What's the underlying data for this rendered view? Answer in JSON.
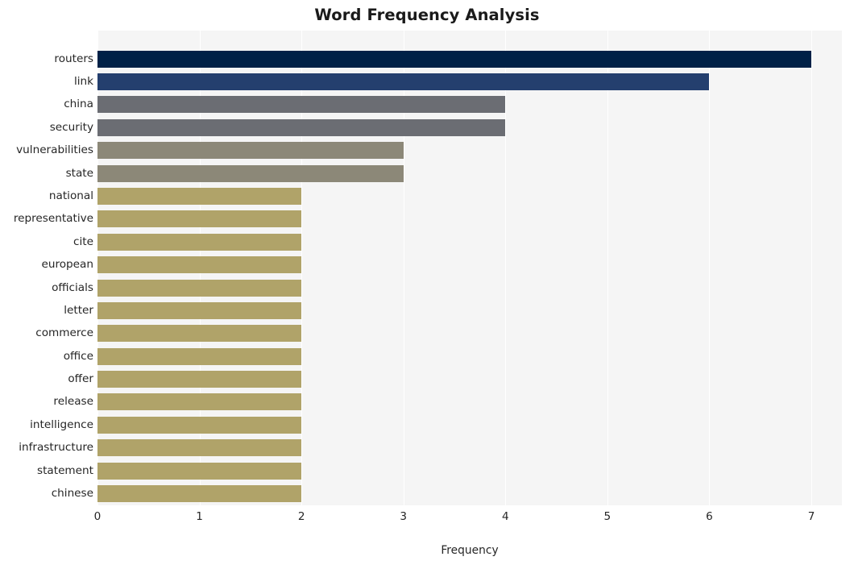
{
  "chart_data": {
    "type": "bar",
    "orientation": "horizontal",
    "title": "Word Frequency Analysis",
    "xlabel": "Frequency",
    "ylabel": "",
    "xlim": [
      0,
      7.3
    ],
    "xticks": [
      0,
      1,
      2,
      3,
      4,
      5,
      6,
      7
    ],
    "xticklabels": [
      "0",
      "1",
      "2",
      "3",
      "4",
      "5",
      "6",
      "7"
    ],
    "grid": true,
    "grid_axis": "x",
    "legend": false,
    "plot_background": "#f5f5f5",
    "figure_background": "#ffffff",
    "gridline_color": "#ffffff",
    "categories": [
      "routers",
      "link",
      "china",
      "security",
      "vulnerabilities",
      "state",
      "national",
      "representative",
      "cite",
      "european",
      "officials",
      "letter",
      "commerce",
      "office",
      "offer",
      "release",
      "intelligence",
      "infrastructure",
      "statement",
      "chinese"
    ],
    "values": [
      7,
      6,
      4,
      4,
      3,
      3,
      2,
      2,
      2,
      2,
      2,
      2,
      2,
      2,
      2,
      2,
      2,
      2,
      2,
      2
    ],
    "bar_colors": [
      "#002147",
      "#243f6e",
      "#6b6d73",
      "#6b6d73",
      "#8c8878",
      "#8c8878",
      "#b0a369",
      "#b0a369",
      "#b0a369",
      "#b0a369",
      "#b0a369",
      "#b0a369",
      "#b0a369",
      "#b0a369",
      "#b0a369",
      "#b0a369",
      "#b0a369",
      "#b0a369",
      "#b0a369",
      "#b0a369"
    ]
  }
}
